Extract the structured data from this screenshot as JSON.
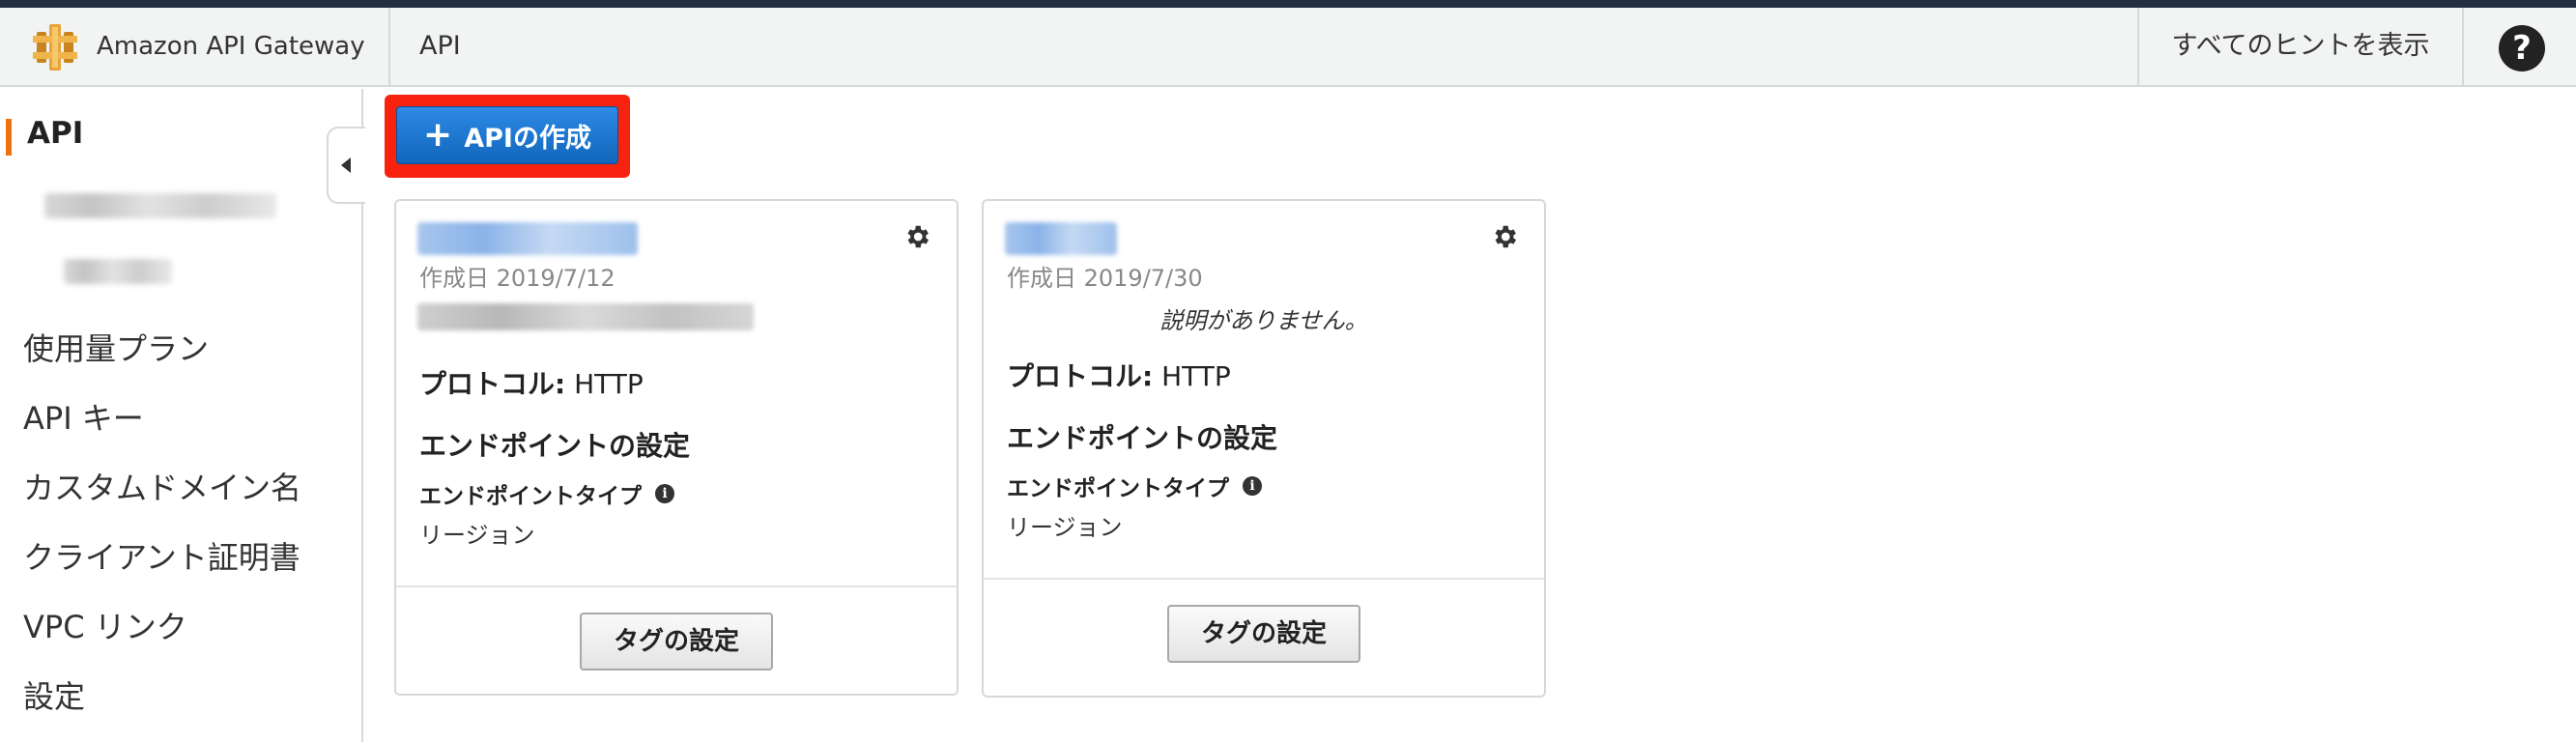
{
  "header": {
    "brand_name": "Amazon API Gateway",
    "breadcrumb": "API",
    "hints_label": "すべてのヒントを表示",
    "help_symbol": "?"
  },
  "sidebar": {
    "active_item": "API",
    "items": [
      {
        "label": "使用量プラン"
      },
      {
        "label": "API キー"
      },
      {
        "label": "カスタムドメイン名"
      },
      {
        "label": "クライアント証明書"
      },
      {
        "label": "VPC リンク"
      },
      {
        "label": "設定"
      }
    ]
  },
  "toolbar": {
    "create_label": "APIの作成",
    "create_icon": "plus-icon"
  },
  "cards": [
    {
      "date": "作成日 2019/7/12",
      "protocol_label": "プロトコル:",
      "protocol_value": "HTTP",
      "endpoint_heading": "エンドポイントの設定",
      "endpoint_type_label": "エンドポイントタイプ",
      "endpoint_type_value": "リージョン",
      "tag_button": "タグの設定",
      "settings_icon": "gear-icon"
    },
    {
      "date": "作成日 2019/7/30",
      "description": "説明がありません。",
      "protocol_label": "プロトコル:",
      "protocol_value": "HTTP",
      "endpoint_heading": "エンドポイントの設定",
      "endpoint_type_label": "エンドポイントタイプ",
      "endpoint_type_value": "リージョン",
      "tag_button": "タグの設定",
      "settings_icon": "gear-icon"
    }
  ],
  "colors": {
    "accent_orange": "#ec7211",
    "highlight_red": "#f8230e",
    "primary_blue": "#1a73d4",
    "top_strip": "#232f3e"
  }
}
